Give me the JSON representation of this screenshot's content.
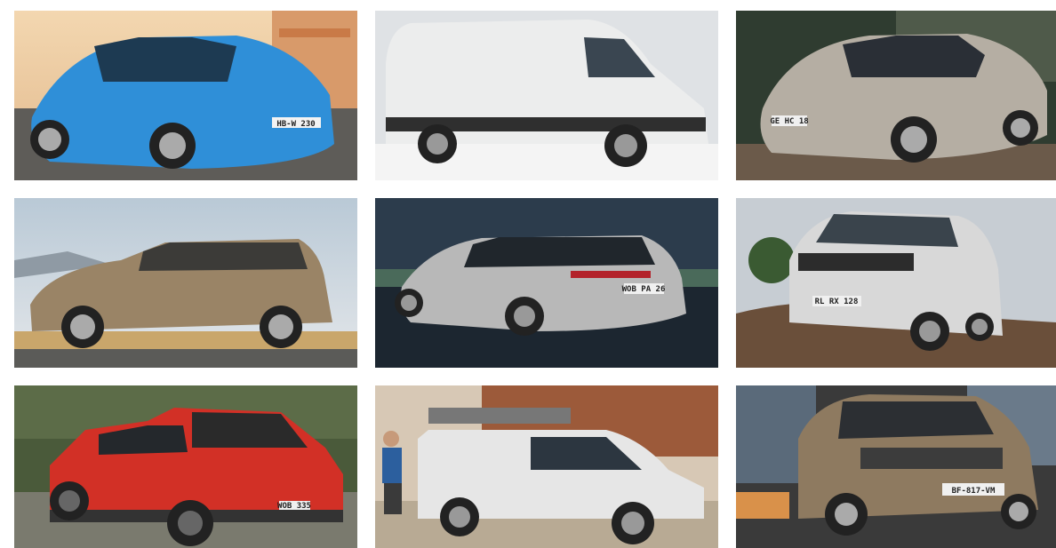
{
  "gallery": {
    "tiles": [
      {
        "subject": "blue hatchback on a street",
        "plate": "HB-W 230",
        "colors": {
          "body": "#2f8fd8",
          "background": "#e9c9a4",
          "ground": "#5a5a55"
        }
      },
      {
        "subject": "white panel van",
        "plate": "",
        "colors": {
          "body": "#e8e9eb",
          "background": "#dcdfe2",
          "ground": "#f2f2f2"
        }
      },
      {
        "subject": "silver hatchback in the evening",
        "plate": "GE HC 18",
        "colors": {
          "body": "#b5aea3",
          "background": "#3a4a3a",
          "ground": "#6b5a4a"
        }
      },
      {
        "subject": "bronze compact MPV",
        "plate": "",
        "colors": {
          "body": "#9a8466",
          "background": "#c6d2dc",
          "ground": "#c9a66b"
        }
      },
      {
        "subject": "silver estate car on wet road",
        "plate": "WOB PA 26",
        "colors": {
          "body": "#b8b8b8",
          "background": "#2c3c4c",
          "ground": "#1c2630"
        }
      },
      {
        "subject": "silver van off road",
        "plate": "RL RX 128",
        "colors": {
          "body": "#d8d8d8",
          "background": "#c7cdd3",
          "ground": "#6a4f3a"
        }
      },
      {
        "subject": "red pickup truck",
        "plate": "WOB 335",
        "colors": {
          "body": "#d23026",
          "background": "#4a5a3a",
          "ground": "#7a7a6e"
        }
      },
      {
        "subject": "white compact van at a building site",
        "plate": "",
        "colors": {
          "body": "#e6e6e6",
          "background": "#9c5a3a",
          "ground": "#b8aa94"
        }
      },
      {
        "subject": "bronze compact SUV in the city",
        "plate": "BF-817-VM",
        "colors": {
          "body": "#8e7a60",
          "background": "#5a6a7a",
          "ground": "#3a3a3a"
        }
      }
    ]
  }
}
